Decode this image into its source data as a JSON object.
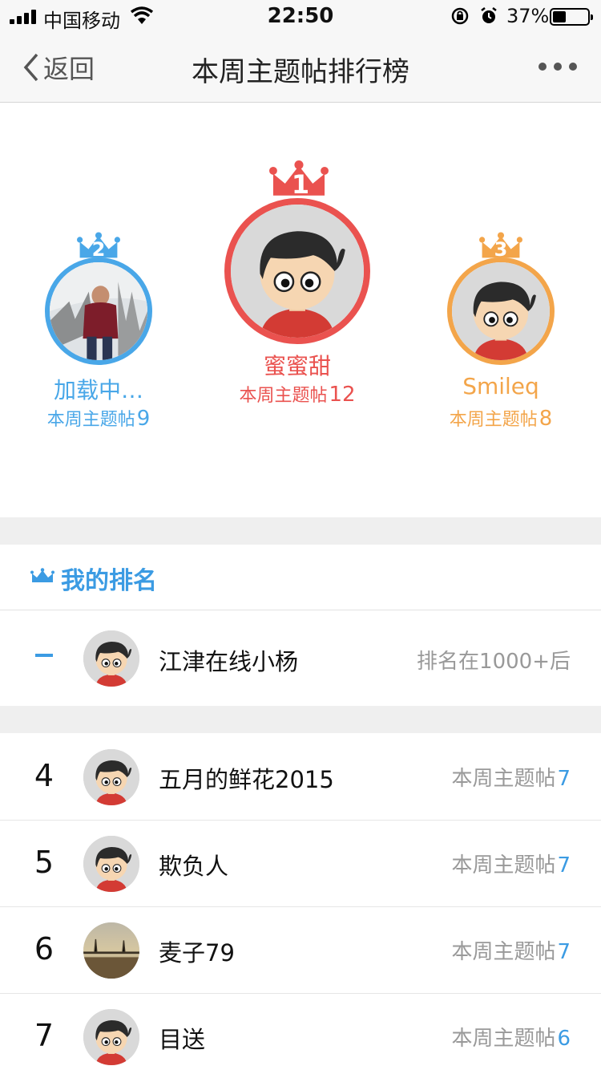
{
  "status_bar": {
    "carrier": "中国移动",
    "time": "22:50",
    "battery_percent": "37%",
    "battery_level": 0.37,
    "icons": [
      "signal-icon",
      "wifi-icon",
      "rotation-lock-icon",
      "alarm-icon",
      "battery-icon"
    ]
  },
  "nav": {
    "back_label": "返回",
    "title": "本周主题帖排行榜",
    "more_icon": "more-dots-icon"
  },
  "podium": {
    "first": {
      "rank": "1",
      "name": "蜜蜜甜",
      "count_label": "本周主题帖",
      "count": "12",
      "color": "#ea524f"
    },
    "second": {
      "rank": "2",
      "name": "加载中…",
      "count_label": "本周主题帖",
      "count": "9",
      "color": "#49a7e8"
    },
    "third": {
      "rank": "3",
      "name": "Smileq",
      "count_label": "本周主题帖",
      "count": "8",
      "color": "#f3a54a"
    }
  },
  "my_rank": {
    "title": "我的排名",
    "rank": "–",
    "name": "江津在线小杨",
    "status": "排名在1000+后"
  },
  "list": [
    {
      "rank": "4",
      "name": "五月的鲜花2015",
      "count_label": "本周主题帖",
      "count": "7"
    },
    {
      "rank": "5",
      "name": "欺负人",
      "count_label": "本周主题帖",
      "count": "7"
    },
    {
      "rank": "6",
      "name": "麦子79",
      "count_label": "本周主题帖",
      "count": "7"
    },
    {
      "rank": "7",
      "name": "目送",
      "count_label": "本周主题帖",
      "count": "6"
    }
  ],
  "colors": {
    "accent_blue": "#3b9be3",
    "gold_red": "#ea524f",
    "silver_blue": "#49a7e8",
    "bronze_orange": "#f3a54a"
  }
}
